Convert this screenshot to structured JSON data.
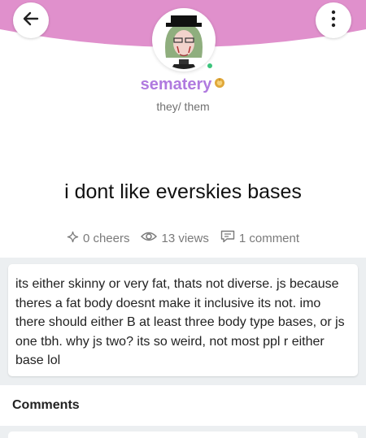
{
  "header": {
    "accent_color": "#e090cc",
    "back_icon": "arrow-left-icon",
    "more_icon": "more-vertical-icon"
  },
  "profile": {
    "username": "sematery",
    "pronouns": "they/ them",
    "badge_icon": "gold-badge-icon",
    "online": true
  },
  "post": {
    "title": "i dont like everskies bases",
    "cheers": "0 cheers",
    "views": "13 views",
    "comments_count": "1 comment",
    "body": "its either skinny or very fat, thats not diverse. js because theres a fat body doesnt make it inclusive its not. imo there should either B at least three body type bases, or js one tbh. why js two? its so weird, not most ppl r either base lol"
  },
  "comments": {
    "title": "Comments"
  }
}
